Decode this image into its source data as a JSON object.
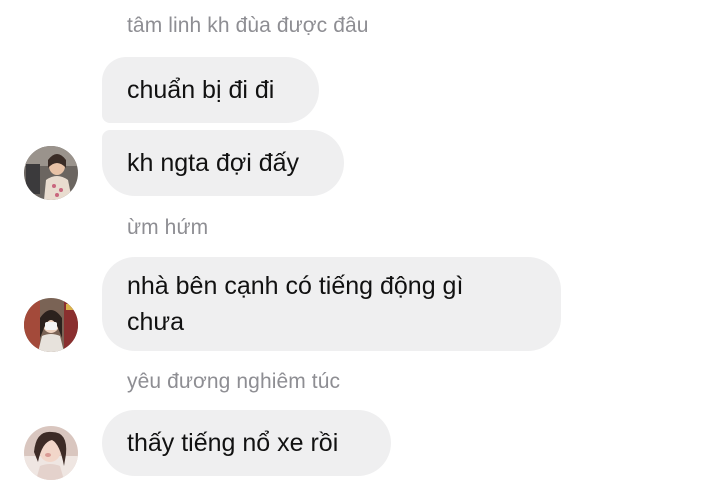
{
  "groups": [
    {
      "sender": "tâm linh kh đùa được đâu",
      "messages": [
        "chuẩn bị đi đi",
        "kh ngta đợi đấy"
      ],
      "avatar_icon": "user-avatar-1"
    },
    {
      "sender": "ừm hứm",
      "messages": [
        "nhà bên cạnh có tiếng động gì\nchưa"
      ],
      "avatar_icon": "user-avatar-2"
    },
    {
      "sender": "yêu đương nghiêm túc",
      "messages": [
        "thấy tiếng nổ xe rồi"
      ],
      "avatar_icon": "user-avatar-3"
    }
  ],
  "colors": {
    "bubble": "#efeff0",
    "sender_text": "#8e8e93",
    "message_text": "#111111"
  }
}
